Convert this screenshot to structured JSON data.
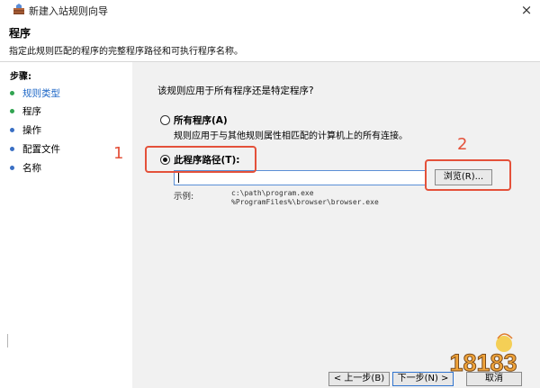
{
  "window": {
    "title": "新建入站规则向导",
    "close_glyph": "×"
  },
  "header": {
    "title": "程序",
    "description": "指定此规则匹配的程序的完整程序路径和可执行程序名称。"
  },
  "sidebar": {
    "title": "步骤:",
    "items": [
      {
        "label": "规则类型",
        "active": true
      },
      {
        "label": "程序",
        "active": false
      },
      {
        "label": "操作",
        "active": false
      },
      {
        "label": "配置文件",
        "active": false
      },
      {
        "label": "名称",
        "active": false
      }
    ]
  },
  "main": {
    "question": "该规则应用于所有程序还是特定程序?",
    "all_programs": {
      "label": "所有程序(A)",
      "description": "规则应用于与其他规则属性相匹配的计算机上的所有连接。",
      "selected": false
    },
    "this_program": {
      "label": "此程序路径(T):",
      "selected": true
    },
    "path_input": {
      "value": ""
    },
    "browse_label": "浏览(R)...",
    "example_label": "示例:",
    "examples": [
      "c:\\path\\program.exe",
      "%ProgramFiles%\\browser\\browser.exe"
    ]
  },
  "annotations": {
    "first": "1",
    "second": "2"
  },
  "footer": {
    "back_label": "< 上一步(B)",
    "next_label": "下一步(N) >",
    "cancel_label": "取消"
  },
  "watermark": {
    "text": "18183"
  },
  "colors": {
    "annotation": "#e4513a",
    "active_step": "#1f68c7",
    "step_dot_green": "#31a451",
    "step_dot_blue": "#3a6fc4",
    "input_border": "#5a8fd6",
    "watermark": "#f0a43a"
  }
}
